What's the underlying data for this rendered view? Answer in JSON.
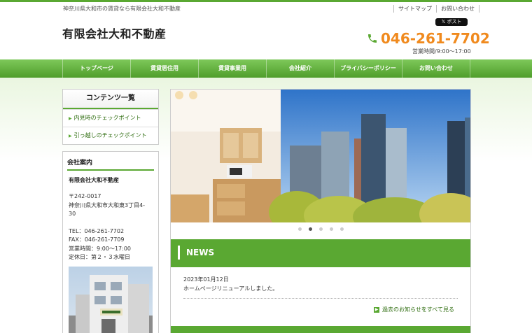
{
  "header": {
    "tagline": "神奈川県大和市の賃貸なら有限会社大和不動産",
    "site_name": "有限会社大和不動産",
    "links": [
      "サイトマップ",
      "お問い合わせ"
    ],
    "x_post_label": "ポスト",
    "phone": "046-261-7702",
    "hours": "営業時間/9:00～17:00"
  },
  "nav": {
    "items": [
      "トップページ",
      "賃貸居住用",
      "賃貸事業用",
      "会社紹介",
      "プライバシーポリシー",
      "お問い合わせ"
    ]
  },
  "sidebar": {
    "contents_title": "コンテンツ一覧",
    "contents_items": [
      "内見時のチェックポイント",
      "引っ越しのチェックポイント"
    ],
    "company_title": "会社案内",
    "company_name": "有限会社大和不動産",
    "postal": "〒242-0017",
    "address_1": "神奈川県大和市大和東3丁目4-",
    "address_2": "30",
    "tel": "TEL：046-261-7702",
    "fax": "FAX：046-261-7709",
    "hours": "営業時間：9:00～17:00",
    "closed": "定休日：第２・３水曜日"
  },
  "slider": {
    "total_slides": 5,
    "active_index": 1
  },
  "news": {
    "title": "NEWS",
    "date": "2023年01月12日",
    "text": "ホームページリニューアルしました。",
    "more_label": "過去のお知らせをすべて見る"
  },
  "colors": {
    "accent_green": "#5aa832",
    "phone_orange": "#f08a1e"
  }
}
